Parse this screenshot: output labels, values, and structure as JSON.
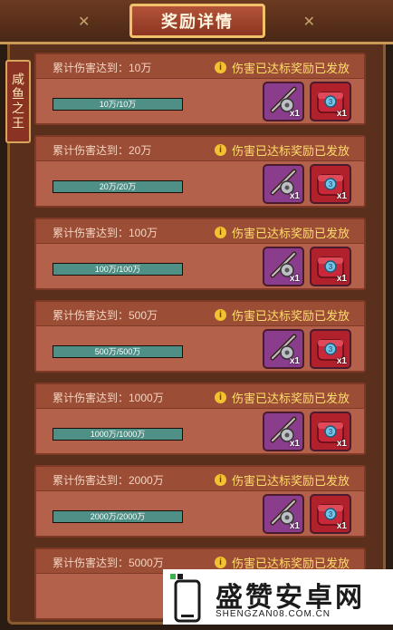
{
  "header": {
    "title": "奖励详情"
  },
  "side_tab": {
    "label": "咸鱼之王"
  },
  "cards": [
    {
      "requirement": "累计伤害达到：10万",
      "status": "伤害已达标奖励已发放",
      "progress_text": "10万/10万",
      "progress": 1.0,
      "rewards": [
        {
          "icon": "fishing-rod-icon",
          "qty": "x1"
        },
        {
          "icon": "red-chest-icon",
          "qty": "x1"
        }
      ]
    },
    {
      "requirement": "累计伤害达到：20万",
      "status": "伤害已达标奖励已发放",
      "progress_text": "20万/20万",
      "progress": 1.0,
      "rewards": [
        {
          "icon": "fishing-rod-icon",
          "qty": "x1"
        },
        {
          "icon": "red-chest-icon",
          "qty": "x1"
        }
      ]
    },
    {
      "requirement": "累计伤害达到：100万",
      "status": "伤害已达标奖励已发放",
      "progress_text": "100万/100万",
      "progress": 1.0,
      "rewards": [
        {
          "icon": "fishing-rod-icon",
          "qty": "x1"
        },
        {
          "icon": "red-chest-icon",
          "qty": "x1"
        }
      ]
    },
    {
      "requirement": "累计伤害达到：500万",
      "status": "伤害已达标奖励已发放",
      "progress_text": "500万/500万",
      "progress": 1.0,
      "rewards": [
        {
          "icon": "fishing-rod-icon",
          "qty": "x1"
        },
        {
          "icon": "red-chest-icon",
          "qty": "x1"
        }
      ]
    },
    {
      "requirement": "累计伤害达到：1000万",
      "status": "伤害已达标奖励已发放",
      "progress_text": "1000万/1000万",
      "progress": 1.0,
      "rewards": [
        {
          "icon": "fishing-rod-icon",
          "qty": "x1"
        },
        {
          "icon": "red-chest-icon",
          "qty": "x1"
        }
      ]
    },
    {
      "requirement": "累计伤害达到：2000万",
      "status": "伤害已达标奖励已发放",
      "progress_text": "2000万/2000万",
      "progress": 1.0,
      "rewards": [
        {
          "icon": "fishing-rod-icon",
          "qty": "x1"
        },
        {
          "icon": "red-chest-icon",
          "qty": "x1"
        }
      ]
    },
    {
      "requirement": "累计伤害达到：5000万",
      "status": "伤害已达标奖励已发放",
      "progress_text": "",
      "progress": 1.0,
      "rewards": []
    }
  ],
  "watermark": {
    "text": "盛赞安卓网",
    "sub": "SHENGZAN08.COM.CN"
  },
  "colors": {
    "accent": "#ffde6a",
    "bar_fill": "#4e8f86",
    "frame": "#5a2f1c"
  }
}
